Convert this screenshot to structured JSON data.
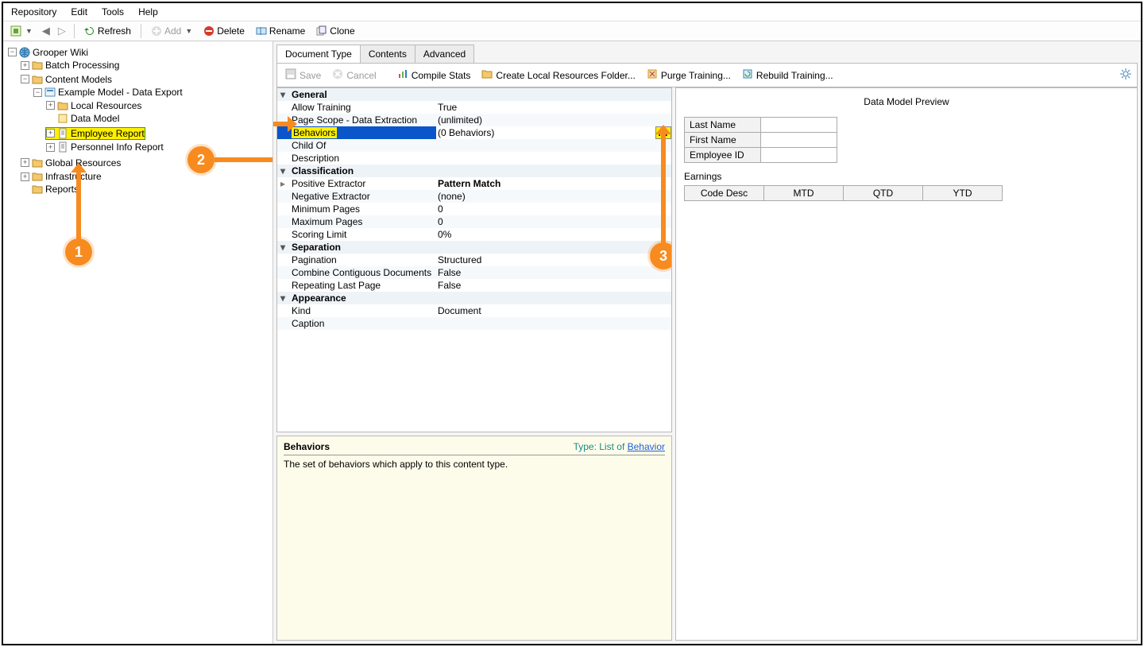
{
  "menu": {
    "repository": "Repository",
    "edit": "Edit",
    "tools": "Tools",
    "help": "Help"
  },
  "toolbar": {
    "refresh": "Refresh",
    "add": "Add",
    "delete": "Delete",
    "rename": "Rename",
    "clone": "Clone"
  },
  "tree": {
    "root": "Grooper Wiki",
    "batch_processing": "Batch Processing",
    "content_models": "Content Models",
    "example_model": "Example Model - Data Export",
    "local_resources": "Local Resources",
    "data_model": "Data Model",
    "employee_report": "Employee Report",
    "personnel_info_report": "Personnel Info Report",
    "global_resources": "Global Resources",
    "infrastructure": "Infrastructure",
    "reports": "Reports"
  },
  "tabs": {
    "doc_type": "Document Type",
    "contents": "Contents",
    "advanced": "Advanced"
  },
  "subtoolbar": {
    "save": "Save",
    "cancel": "Cancel",
    "compile_stats": "Compile Stats",
    "create_local": "Create Local Resources Folder...",
    "purge_training": "Purge Training...",
    "rebuild_training": "Rebuild Training..."
  },
  "props": {
    "groups": {
      "general": "General",
      "classification": "Classification",
      "separation": "Separation",
      "appearance": "Appearance"
    },
    "general": {
      "allow_training": {
        "name": "Allow Training",
        "value": "True"
      },
      "page_scope": {
        "name": "Page Scope - Data Extraction",
        "value": "(unlimited)"
      },
      "behaviors": {
        "name": "Behaviors",
        "value": "(0 Behaviors)"
      },
      "child_of": {
        "name": "Child Of",
        "value": ""
      },
      "description": {
        "name": "Description",
        "value": ""
      }
    },
    "classification": {
      "positive_extractor": {
        "name": "Positive Extractor",
        "value": "Pattern Match"
      },
      "negative_extractor": {
        "name": "Negative Extractor",
        "value": "(none)"
      },
      "minimum_pages": {
        "name": "Minimum Pages",
        "value": "0"
      },
      "maximum_pages": {
        "name": "Maximum Pages",
        "value": "0"
      },
      "scoring_limit": {
        "name": "Scoring Limit",
        "value": "0%"
      }
    },
    "separation": {
      "pagination": {
        "name": "Pagination",
        "value": "Structured"
      },
      "combine": {
        "name": "Combine Contiguous Documents",
        "value": "False"
      },
      "repeating": {
        "name": "Repeating Last Page",
        "value": "False"
      }
    },
    "appearance": {
      "kind": {
        "name": "Kind",
        "value": "Document"
      },
      "caption": {
        "name": "Caption",
        "value": ""
      }
    }
  },
  "desc": {
    "title": "Behaviors",
    "type_label": "Type: List of ",
    "type_link": "Behavior",
    "body": "The set of behaviors which apply to this content type."
  },
  "preview": {
    "title": "Data Model Preview",
    "fields": {
      "last_name": "Last Name",
      "first_name": "First Name",
      "employee_id": "Employee ID"
    },
    "earnings_label": "Earnings",
    "earnings_cols": {
      "code_desc": "Code Desc",
      "mtd": "MTD",
      "qtd": "QTD",
      "ytd": "YTD"
    }
  },
  "callouts": {
    "one": "1",
    "two": "2",
    "three": "3"
  },
  "ellipsis": "..."
}
